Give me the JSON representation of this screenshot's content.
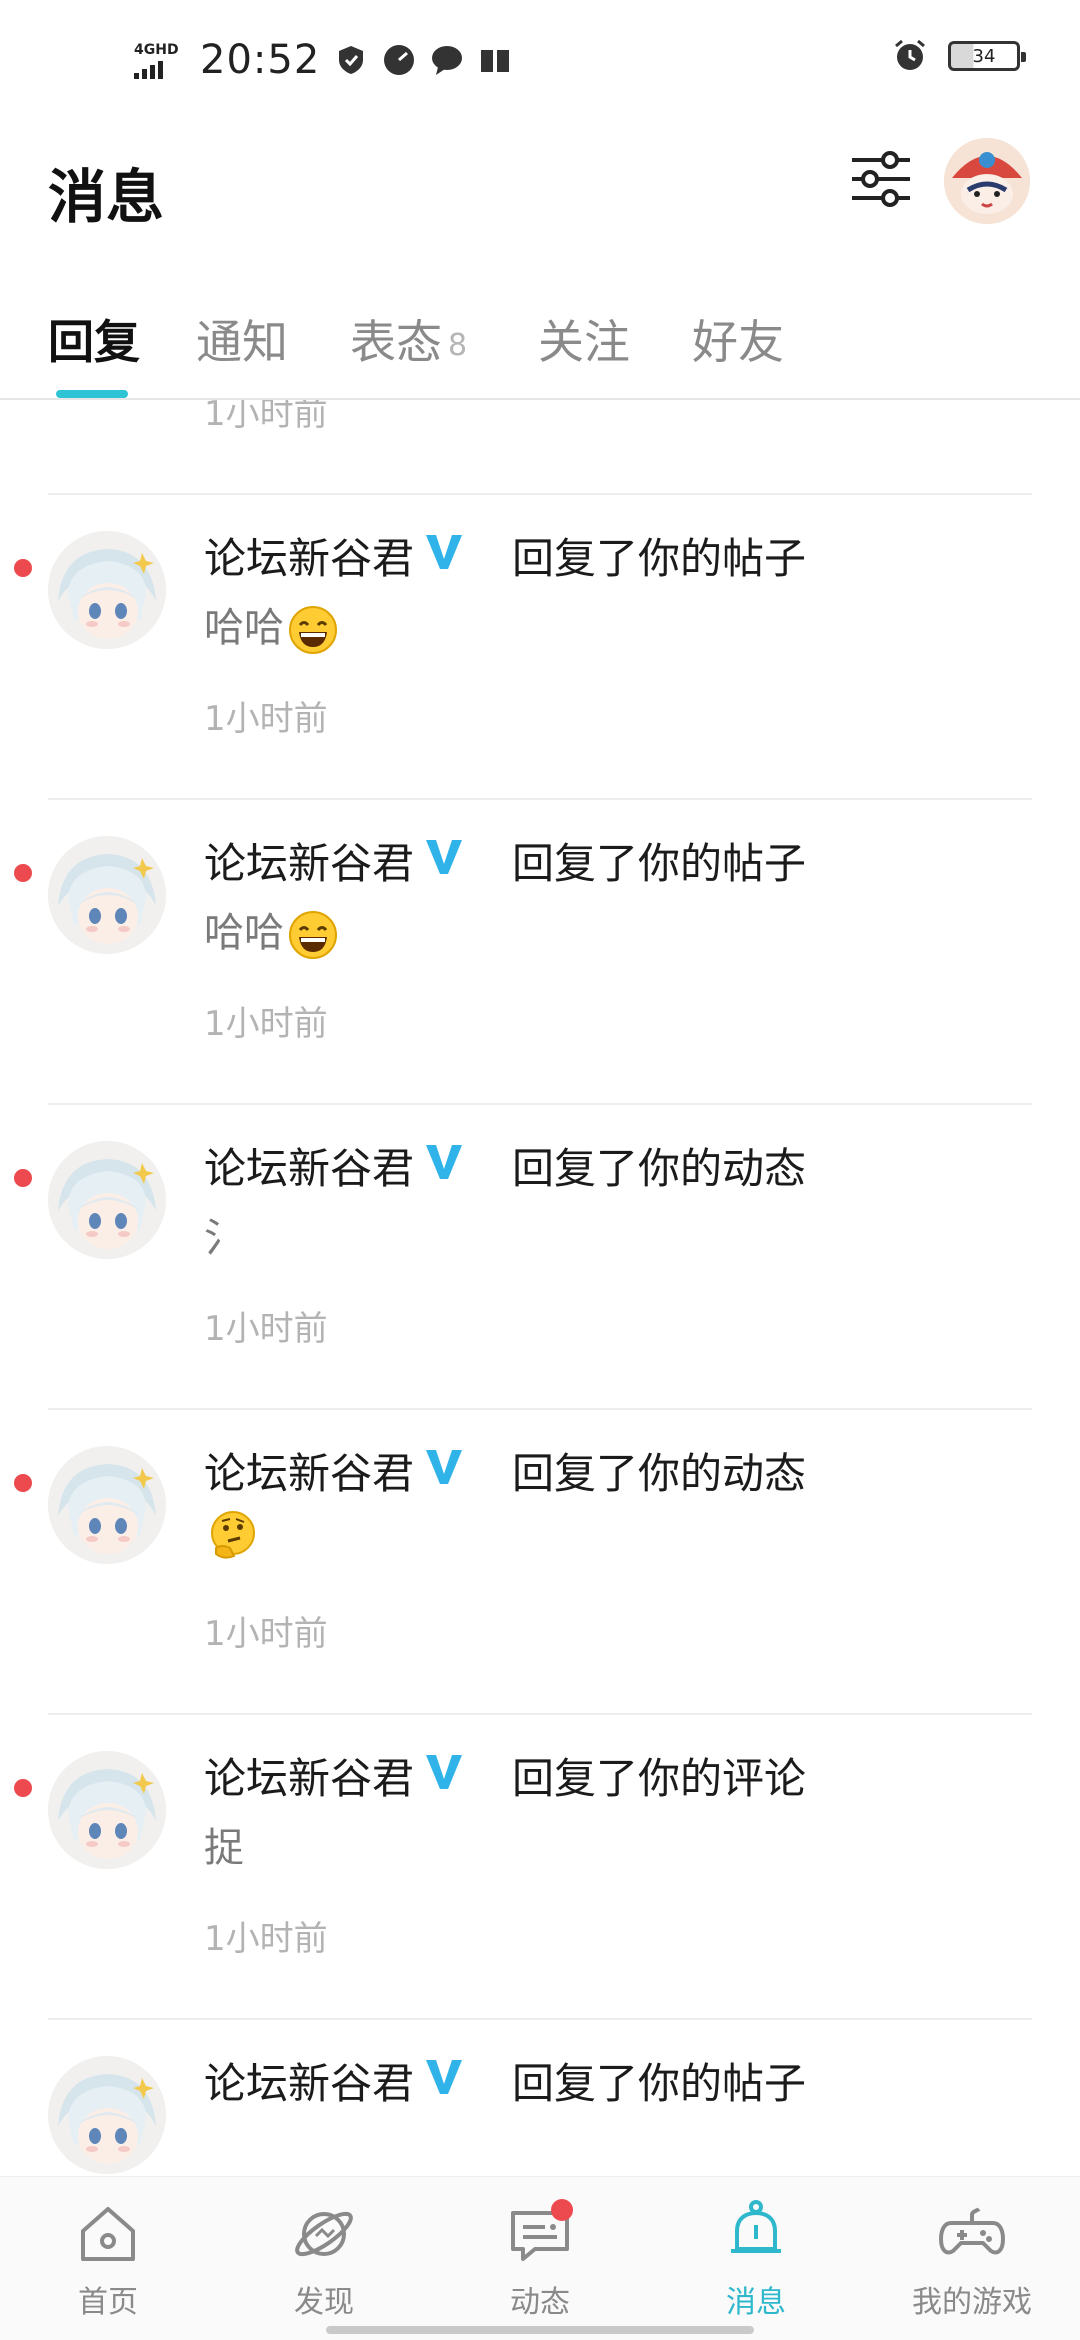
{
  "status_bar": {
    "network": "4GHD",
    "time": "20:52",
    "battery": "34"
  },
  "header": {
    "title": "消息"
  },
  "tabs": [
    {
      "label": "回复",
      "badge": ""
    },
    {
      "label": "通知",
      "badge": ""
    },
    {
      "label": "表态",
      "badge": "8"
    },
    {
      "label": "关注",
      "badge": ""
    },
    {
      "label": "好友",
      "badge": ""
    }
  ],
  "colors": {
    "accent": "#2fc3d6",
    "unread": "#ec4a4f",
    "verified": "#2fb3e8"
  },
  "messages": [
    {
      "user": "",
      "action": "",
      "content": "",
      "time": "1小时前",
      "unread": false
    },
    {
      "user": "论坛新谷君",
      "action": "回复了你的帖子",
      "content": "哈哈",
      "emoji": "grinning-emoji",
      "time": "1小时前",
      "unread": true
    },
    {
      "user": "论坛新谷君",
      "action": "回复了你的帖子",
      "content": "哈哈",
      "emoji": "grinning-emoji",
      "time": "1小时前",
      "unread": true
    },
    {
      "user": "论坛新谷君",
      "action": "回复了你的动态",
      "content": "氵",
      "emoji": "",
      "time": "1小时前",
      "unread": true
    },
    {
      "user": "论坛新谷君",
      "action": "回复了你的动态",
      "content": "",
      "emoji": "thinking-emoji",
      "time": "1小时前",
      "unread": true
    },
    {
      "user": "论坛新谷君",
      "action": "回复了你的评论",
      "content": "捉",
      "emoji": "",
      "time": "1小时前",
      "unread": true
    },
    {
      "user": "论坛新谷君",
      "action": "回复了你的帖子",
      "content": "",
      "emoji": "",
      "time": "",
      "unread": false
    }
  ],
  "bottom_nav": [
    {
      "label": "首页",
      "icon": "home-icon"
    },
    {
      "label": "发现",
      "icon": "planet-icon"
    },
    {
      "label": "动态",
      "icon": "chat-icon"
    },
    {
      "label": "消息",
      "icon": "bell-icon"
    },
    {
      "label": "我的游戏",
      "icon": "gamepad-icon"
    }
  ]
}
